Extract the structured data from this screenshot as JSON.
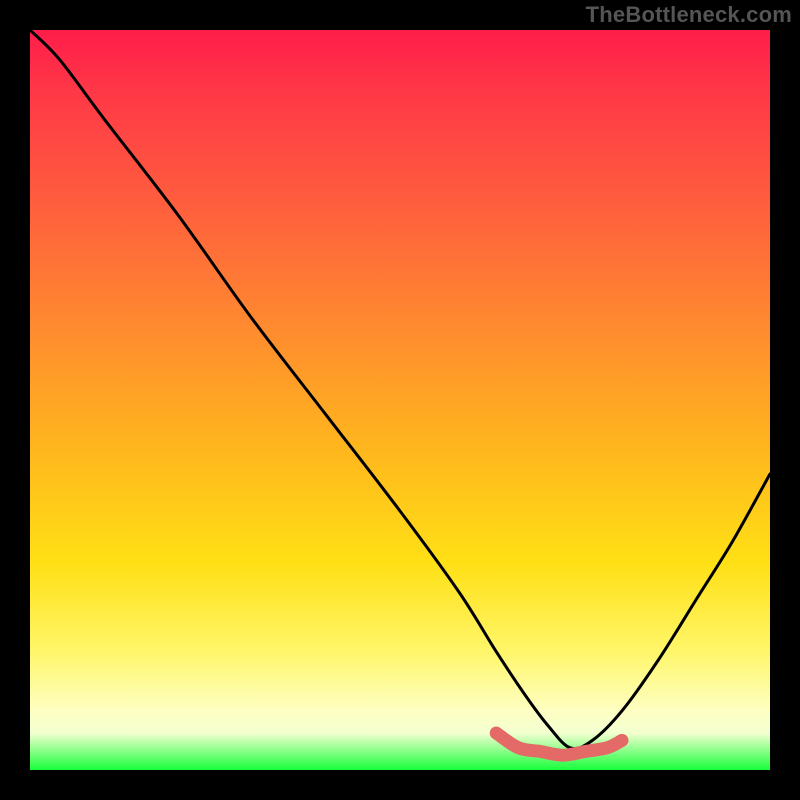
{
  "watermark": "TheBottleneck.com",
  "chart_data": {
    "type": "line",
    "title": "",
    "xlabel": "",
    "ylabel": "",
    "xlim": [
      0,
      100
    ],
    "ylim": [
      0,
      100
    ],
    "description": "Bottleneck curve over a red-to-green vertical gradient. High (red) values = large bottleneck, low (green) = balanced. Minimum near x≈73.",
    "series": [
      {
        "name": "bottleneck-curve",
        "color": "#000000",
        "x": [
          0,
          4,
          10,
          20,
          30,
          40,
          50,
          58,
          63,
          67,
          70,
          73,
          76,
          80,
          85,
          90,
          95,
          100
        ],
        "values": [
          100,
          96,
          88,
          75,
          61,
          48,
          35,
          24,
          16,
          10,
          6,
          3,
          4,
          8,
          15,
          23,
          31,
          40
        ]
      }
    ],
    "marker": {
      "name": "optimal-region",
      "color": "#e46a67",
      "x": [
        63,
        66,
        69,
        72,
        75,
        78,
        80
      ],
      "values": [
        5,
        3,
        2.5,
        2,
        2.5,
        3,
        4
      ]
    },
    "gradient_stops": [
      {
        "pos": 0,
        "color": "#ff1d4a"
      },
      {
        "pos": 22,
        "color": "#ff5a3f"
      },
      {
        "pos": 55,
        "color": "#ffb21f"
      },
      {
        "pos": 84,
        "color": "#fff66a"
      },
      {
        "pos": 100,
        "color": "#18ff3c"
      }
    ]
  }
}
